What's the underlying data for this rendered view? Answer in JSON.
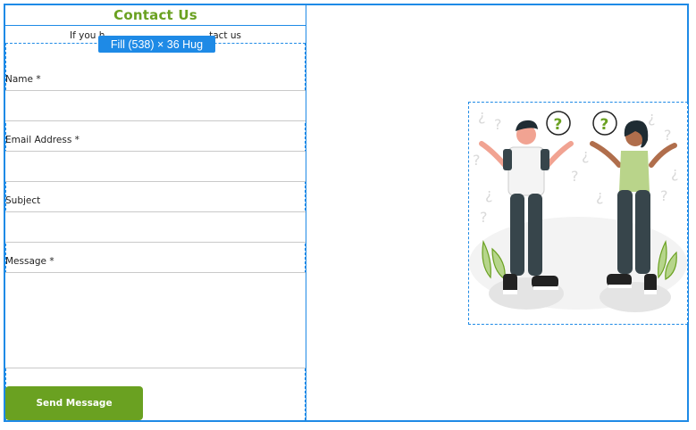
{
  "overlay": {
    "fill_badge": "Fill (538) × 36 Hug"
  },
  "contact": {
    "title": "Contact Us",
    "subtitle_left": "If you h",
    "subtitle_right": "tact us"
  },
  "form": {
    "name_label": "Name *",
    "email_label": "Email Address *",
    "subject_label": "Subject",
    "message_label": "Message *",
    "send_label": "Send Message"
  },
  "illustration": {
    "name": "two-people-confused-illustration"
  },
  "colors": {
    "accent": "#6aa121",
    "selection": "#1e8ae6"
  }
}
